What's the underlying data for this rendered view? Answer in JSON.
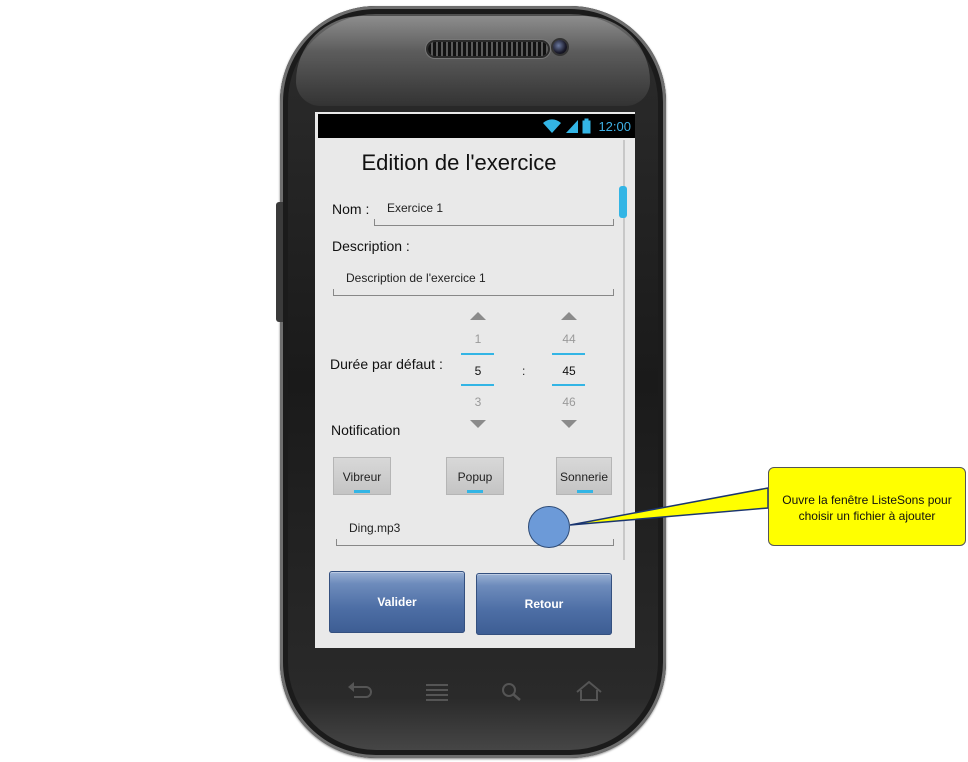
{
  "status_bar": {
    "time": "12:00",
    "wifi_icon": "wifi-icon",
    "signal_icon": "signal-icon",
    "battery_icon": "battery-icon",
    "accent_color": "#33b5e5"
  },
  "page": {
    "title": "Edition de l'exercice"
  },
  "form": {
    "nom_label": "Nom :",
    "nom_value": "Exercice 1",
    "description_label": "Description :",
    "description_value": "Description de l'exercice 1",
    "duree_label": "Durée par défaut :",
    "duree_separator": ":",
    "minutes_picker": {
      "prev": "1",
      "current": "5",
      "next": "3"
    },
    "seconds_picker": {
      "prev": "44",
      "current": "45",
      "next": "46"
    },
    "notification_label": "Notification",
    "toggles": [
      "Vibreur",
      "Popup",
      "Sonnerie"
    ],
    "sound_file": "Ding.mp3"
  },
  "buttons": {
    "valider": "Valider",
    "retour": "Retour"
  },
  "nav_bar": {
    "icons": [
      "back-icon",
      "menu-icon",
      "search-icon",
      "home-icon"
    ]
  },
  "annotation": {
    "callout_text": "Ouvre la fenêtre ListeSons pour choisir un fichier à ajouter",
    "callout_color": "#ffff00"
  }
}
